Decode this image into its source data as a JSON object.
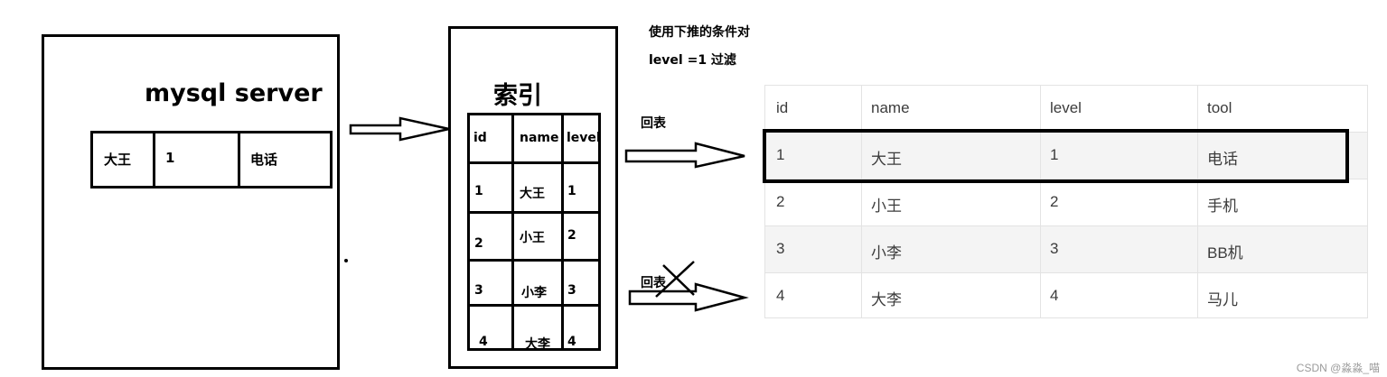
{
  "server": {
    "title": "mysql server",
    "row": [
      "大王",
      "1",
      "电话"
    ]
  },
  "index": {
    "title": "索引",
    "headers": [
      "id",
      "name",
      "level"
    ],
    "rows": [
      [
        "1",
        "大王",
        "1"
      ],
      [
        "2",
        "小王",
        "2"
      ],
      [
        "3",
        "小李",
        "3"
      ],
      [
        "4",
        "大李",
        "4"
      ]
    ]
  },
  "notes": {
    "pushdown_line1": "使用下推的条件对",
    "pushdown_line2": "level =1 过滤",
    "lookup_1": "回表",
    "lookup_2": "回表"
  },
  "result_table": {
    "headers": [
      "id",
      "name",
      "level",
      "tool"
    ],
    "rows": [
      [
        "1",
        "大王",
        "1",
        "电话"
      ],
      [
        "2",
        "小王",
        "2",
        "手机"
      ],
      [
        "3",
        "小李",
        "3",
        "BB机"
      ],
      [
        "4",
        "大李",
        "4",
        "马儿"
      ]
    ]
  },
  "watermark": "CSDN @淼淼_喵"
}
